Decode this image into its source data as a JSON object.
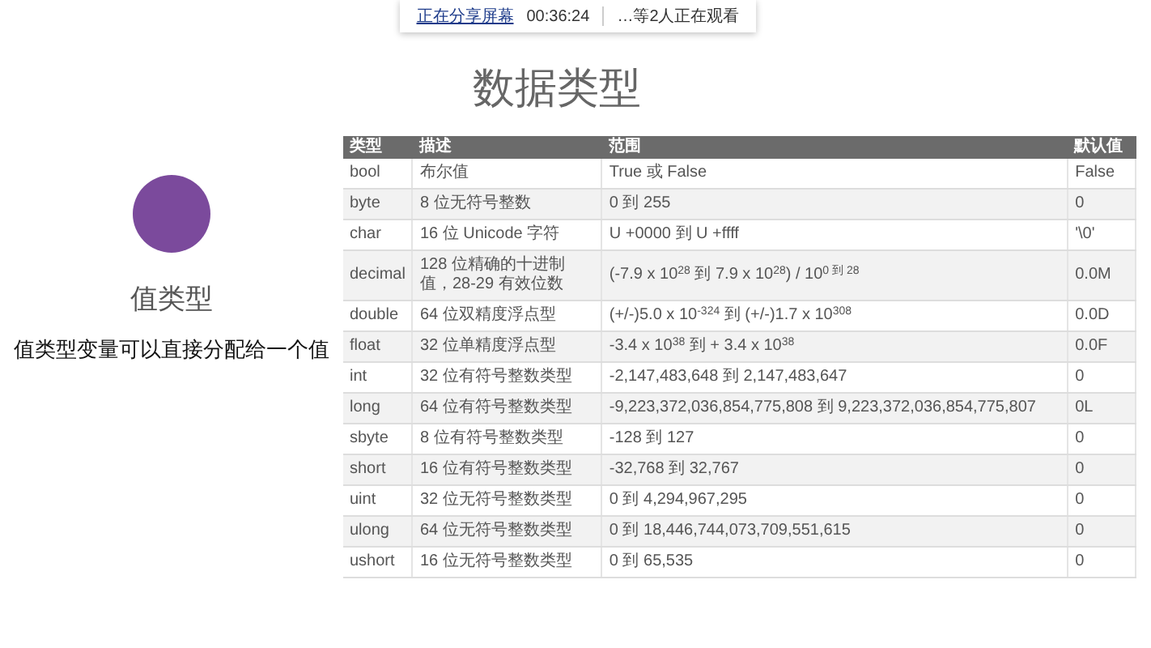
{
  "share_bar": {
    "status": "正在分享屏幕",
    "timer": "00:36:24",
    "viewers": "…等2人正在观看"
  },
  "left_panel": {
    "circle_label": "值类型",
    "description": "值类型变量可以直接分配给一个值"
  },
  "title": "数据类型",
  "table": {
    "columns": [
      "类型",
      "描述",
      "范围",
      "默认值"
    ],
    "rows": [
      [
        "bool",
        "布尔值",
        "True 或 False",
        "False"
      ],
      [
        "byte",
        "8 位无符号整数",
        "0 到 255",
        "0"
      ],
      [
        "char",
        "16 位 Unicode 字符",
        "U +0000 到 U +ffff",
        "'\\0'"
      ],
      [
        "decimal",
        "128 位精确的十进制值，28-29 有效位数",
        "(-7.9 x 10$^{28}$ 到 7.9 x 10$^{28}$) / 10$^{0 到 28}$",
        "0.0M"
      ],
      [
        "double",
        "64 位双精度浮点型",
        "(+/-)5.0 x 10$^{-324}$ 到 (+/-)1.7 x 10$^{308}$",
        "0.0D"
      ],
      [
        "float",
        "32 位单精度浮点型",
        "-3.4 x 10$^{38}$ 到 + 3.4 x 10$^{38}$",
        "0.0F"
      ],
      [
        "int",
        "32 位有符号整数类型",
        "-2,147,483,648 到 2,147,483,647",
        "0"
      ],
      [
        "long",
        "64 位有符号整数类型",
        "-9,223,372,036,854,775,808 到 9,223,372,036,854,775,807",
        "0L"
      ],
      [
        "sbyte",
        "8 位有符号整数类型",
        "-128 到 127",
        "0"
      ],
      [
        "short",
        "16 位有符号整数类型",
        "-32,768 到 32,767",
        "0"
      ],
      [
        "uint",
        "32 位无符号整数类型",
        "0 到 4,294,967,295",
        "0"
      ],
      [
        "ulong",
        "64 位无符号整数类型",
        "0 到 18,446,744,073,709,551,615",
        "0"
      ],
      [
        "ushort",
        "16 位无符号整数类型",
        "0 到 65,535",
        "0"
      ]
    ]
  }
}
